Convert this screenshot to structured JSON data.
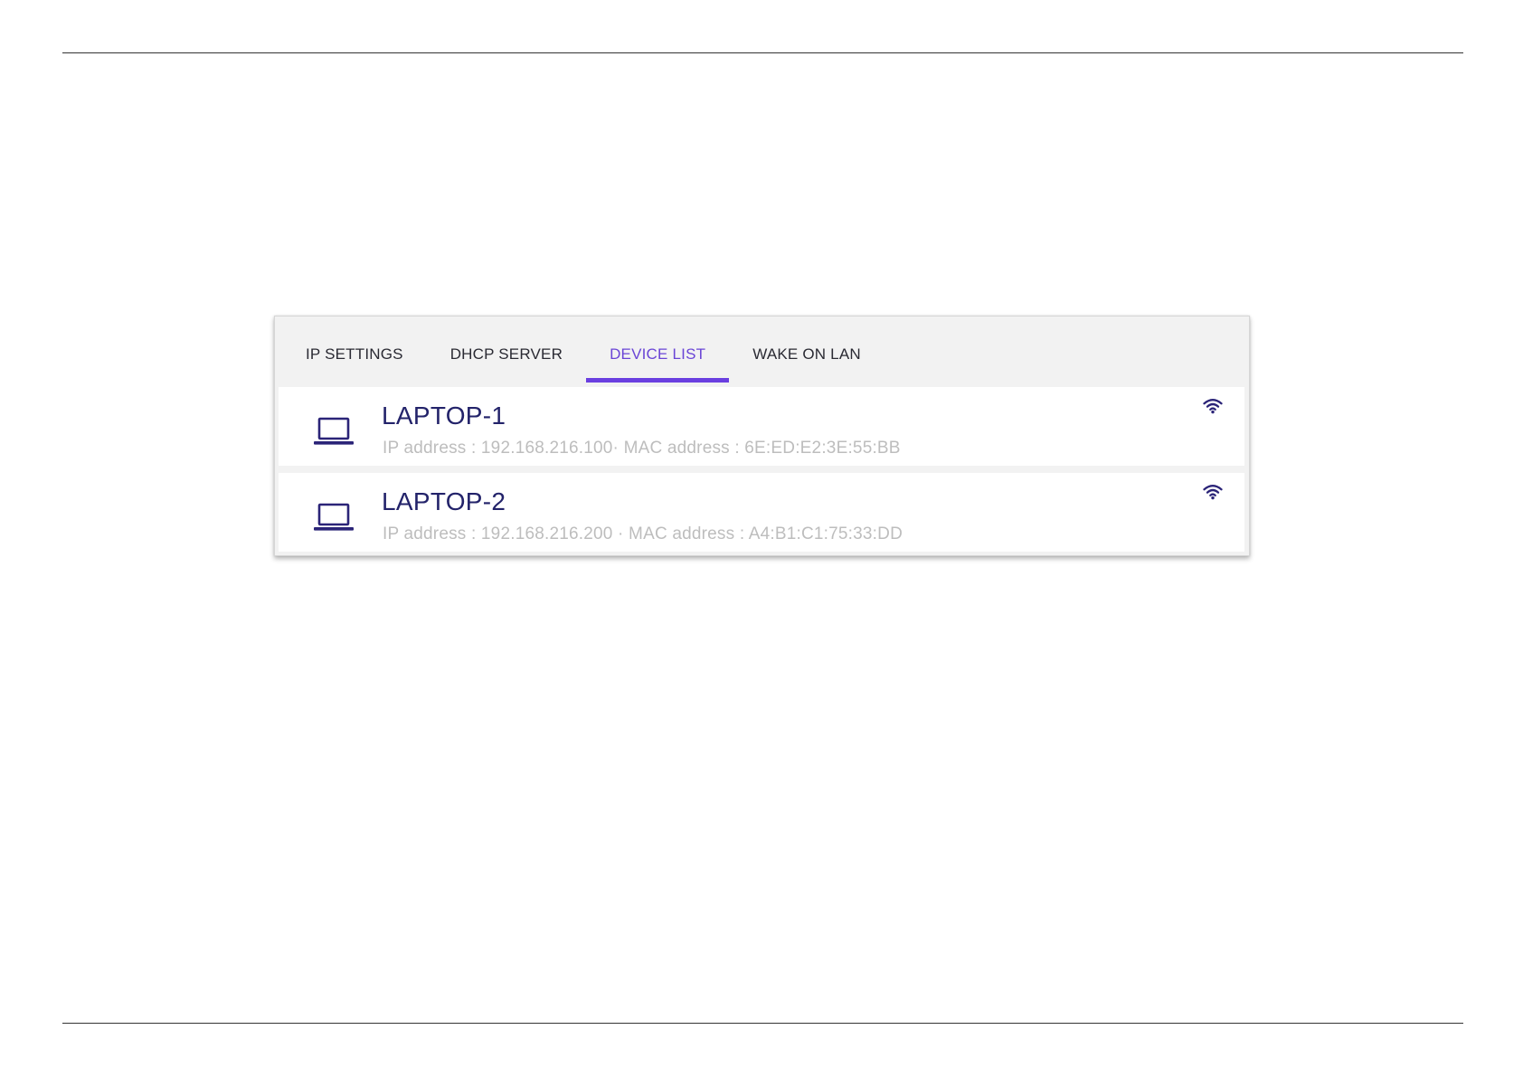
{
  "tabs": [
    {
      "label": "IP SETTINGS",
      "active": false
    },
    {
      "label": "DHCP SERVER",
      "active": false
    },
    {
      "label": "DEVICE LIST",
      "active": true
    },
    {
      "label": "WAKE ON LAN",
      "active": false
    }
  ],
  "devices": [
    {
      "name": "LAPTOP-1",
      "details": "IP address : 192.168.216.100· MAC address : 6E:ED:E2:3E:55:BB",
      "icon": "laptop-icon",
      "connection_icon": "wifi-icon"
    },
    {
      "name": "LAPTOP-2",
      "details": "IP address : 192.168.216.200 · MAC address : A4:B1:C1:75:33:DD",
      "icon": "laptop-icon",
      "connection_icon": "wifi-icon"
    }
  ],
  "colors": {
    "accent": "#6a3fe0",
    "active_tab_text": "#6a45d6",
    "device_name": "#23236a",
    "device_details": "#bdbdbd",
    "icon": "#2b2478",
    "tabbar_background": "#f2f2f2"
  }
}
